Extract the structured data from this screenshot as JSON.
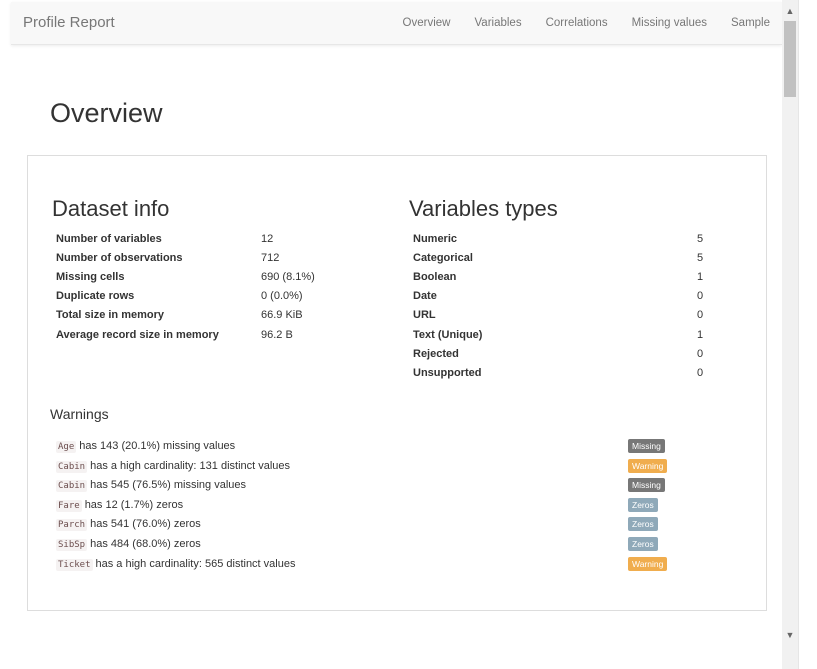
{
  "nav": {
    "brand": "Profile Report",
    "links": [
      "Overview",
      "Variables",
      "Correlations",
      "Missing values",
      "Sample"
    ]
  },
  "page_title": "Overview",
  "dataset_info": {
    "title": "Dataset info",
    "rows": [
      {
        "label": "Number of variables",
        "value": "12"
      },
      {
        "label": "Number of observations",
        "value": "712"
      },
      {
        "label": "Missing cells",
        "value": "690 (8.1%)"
      },
      {
        "label": "Duplicate rows",
        "value": "0 (0.0%)"
      },
      {
        "label": "Total size in memory",
        "value": "66.9 KiB"
      },
      {
        "label": "Average record size in memory",
        "value": "96.2 B"
      }
    ]
  },
  "variable_types": {
    "title": "Variables types",
    "rows": [
      {
        "label": "Numeric",
        "value": "5"
      },
      {
        "label": "Categorical",
        "value": "5"
      },
      {
        "label": "Boolean",
        "value": "1"
      },
      {
        "label": "Date",
        "value": "0"
      },
      {
        "label": "URL",
        "value": "0"
      },
      {
        "label": "Text (Unique)",
        "value": "1"
      },
      {
        "label": "Rejected",
        "value": "0"
      },
      {
        "label": "Unsupported",
        "value": "0"
      }
    ]
  },
  "warnings": {
    "title": "Warnings",
    "items": [
      {
        "var": "Age",
        "text": "has 143 (20.1%) missing values",
        "badge": "Missing"
      },
      {
        "var": "Cabin",
        "text": "has a high cardinality: 131 distinct values",
        "badge": "Warning"
      },
      {
        "var": "Cabin",
        "text": "has 545 (76.5%) missing values",
        "badge": "Missing"
      },
      {
        "var": "Fare",
        "text": "has 12 (1.7%) zeros",
        "badge": "Zeros"
      },
      {
        "var": "Parch",
        "text": "has 541 (76.0%) zeros",
        "badge": "Zeros"
      },
      {
        "var": "SibSp",
        "text": "has 484 (68.0%) zeros",
        "badge": "Zeros"
      },
      {
        "var": "Ticket",
        "text": "has a high cardinality: 565 distinct values",
        "badge": "Warning"
      }
    ]
  },
  "badge_colors": {
    "Missing": "#777777",
    "Warning": "#f0ad4e",
    "Zeros": "#8fa9b9"
  }
}
